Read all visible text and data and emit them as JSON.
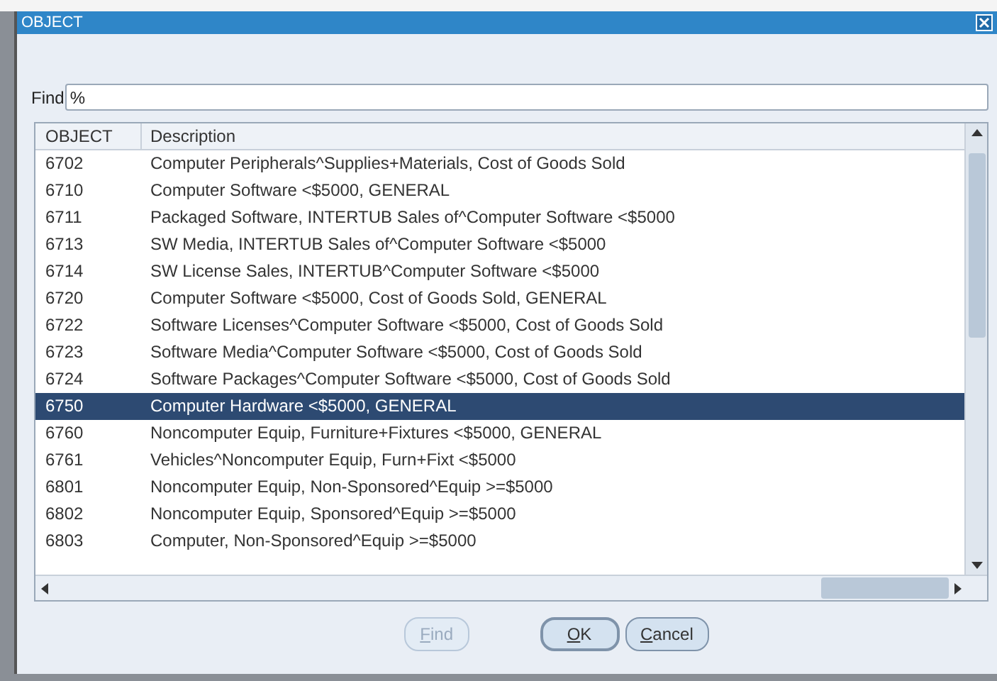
{
  "window": {
    "title": "OBJECT"
  },
  "find": {
    "label": "Find",
    "value": "%"
  },
  "table": {
    "columns": [
      "OBJECT",
      "Description"
    ],
    "rows": [
      {
        "object": "6702",
        "description": "Computer Peripherals^Supplies+Materials, Cost of Goods Sold",
        "selected": false
      },
      {
        "object": "6710",
        "description": "Computer Software <$5000, GENERAL",
        "selected": false
      },
      {
        "object": "6711",
        "description": "Packaged Software, INTERTUB Sales of^Computer Software <$5000",
        "selected": false
      },
      {
        "object": "6713",
        "description": "SW Media, INTERTUB Sales of^Computer Software <$5000",
        "selected": false
      },
      {
        "object": "6714",
        "description": "SW License Sales, INTERTUB^Computer Software <$5000",
        "selected": false
      },
      {
        "object": "6720",
        "description": "Computer Software <$5000, Cost of Goods Sold, GENERAL",
        "selected": false
      },
      {
        "object": "6722",
        "description": "Software Licenses^Computer Software <$5000, Cost of Goods Sold",
        "selected": false
      },
      {
        "object": "6723",
        "description": "Software Media^Computer Software <$5000, Cost of Goods Sold",
        "selected": false
      },
      {
        "object": "6724",
        "description": "Software Packages^Computer Software <$5000, Cost of Goods Sold",
        "selected": false
      },
      {
        "object": "6750",
        "description": "Computer Hardware <$5000, GENERAL",
        "selected": true
      },
      {
        "object": "6760",
        "description": "Noncomputer Equip, Furniture+Fixtures <$5000, GENERAL",
        "selected": false
      },
      {
        "object": "6761",
        "description": "Vehicles^Noncomputer Equip, Furn+Fixt <$5000",
        "selected": false
      },
      {
        "object": "6801",
        "description": "Noncomputer Equip, Non-Sponsored^Equip >=$5000",
        "selected": false
      },
      {
        "object": "6802",
        "description": "Noncomputer Equip, Sponsored^Equip >=$5000",
        "selected": false
      },
      {
        "object": "6803",
        "description": "Computer, Non-Sponsored^Equip >=$5000",
        "selected": false
      }
    ]
  },
  "buttons": [
    {
      "label": "Find",
      "disabled": true,
      "default": false
    },
    {
      "label": "OK",
      "disabled": false,
      "default": true
    },
    {
      "label": "Cancel",
      "disabled": false,
      "default": false
    }
  ]
}
